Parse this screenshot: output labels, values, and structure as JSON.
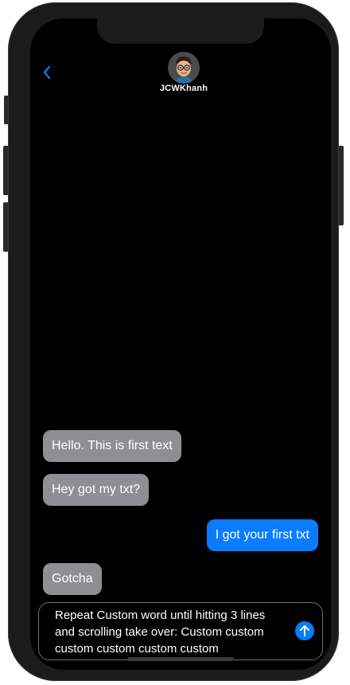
{
  "header": {
    "back_icon": "chevron-left-icon",
    "contact_name": "JCWKhanh",
    "avatar_icon": "memoji-avatar"
  },
  "messages": [
    {
      "text": "Hello. This is first text",
      "direction": "received"
    },
    {
      "text": "Hey got my txt?",
      "direction": "received"
    },
    {
      "text": "I got your first txt",
      "direction": "sent"
    },
    {
      "text": "Gotcha",
      "direction": "received"
    }
  ],
  "composer": {
    "value": "Repeat Custom word until hitting 3 lines and scrolling take over: Custom custom custom custom custom custom",
    "send_icon": "arrow-up-icon"
  },
  "colors": {
    "accent": "#0a7cff",
    "received_bubble": "#8e8e93",
    "background": "#000000"
  }
}
